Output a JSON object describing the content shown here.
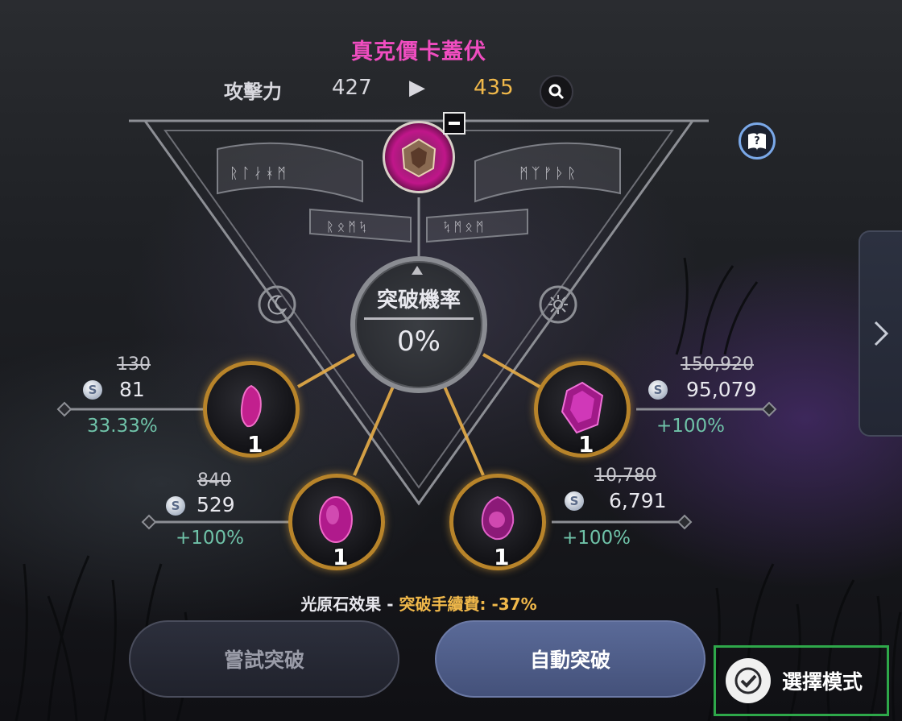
{
  "title": "真克價卡蓋伏",
  "stats": {
    "label": "攻擊力",
    "current": "427",
    "arrow": "▶",
    "next": "435"
  },
  "runes": {
    "left_banner": "ᚱᛚᛅᚼᛗ",
    "right_banner": "ᛗᛉᚠᚦᚱ",
    "bottom_left": "ᚱᛟᛗᛪ",
    "bottom_right": "ᛪᛗᛟᛗ"
  },
  "rate": {
    "label": "突破機率",
    "value": "0%"
  },
  "slots": [
    {
      "id": "top-left",
      "count": "1",
      "price_old": "130",
      "price_new": "81",
      "percent": "33.33%"
    },
    {
      "id": "top-right",
      "count": "1",
      "price_old": "150,920",
      "price_new": "95,079",
      "percent": "+100%"
    },
    {
      "id": "bottom-left",
      "count": "1",
      "price_old": "840",
      "price_new": "529",
      "percent": "+100%"
    },
    {
      "id": "bottom-right",
      "count": "1",
      "price_old": "10,780",
      "price_new": "6,791",
      "percent": "+100%"
    }
  ],
  "coin_symbol": "S",
  "effect": {
    "prefix": "光原石效果 - ",
    "highlight": "突破手續費: -37%"
  },
  "buttons": {
    "try": "嘗試突破",
    "auto": "自動突破",
    "select_mode": "選擇模式"
  },
  "icons": {
    "search": "search-icon",
    "help": "help-book-icon",
    "minus": "minus-icon",
    "check": "check-icon",
    "chevron": "chevron-right-icon",
    "moon": "moon-icon",
    "sun": "sun-icon"
  },
  "colors": {
    "title": "#f04dc0",
    "upgrade_value": "#f0b84a",
    "percent": "#6fc2a8",
    "slot_border": "#b8842a",
    "select_mode_border": "#2ea84a"
  }
}
